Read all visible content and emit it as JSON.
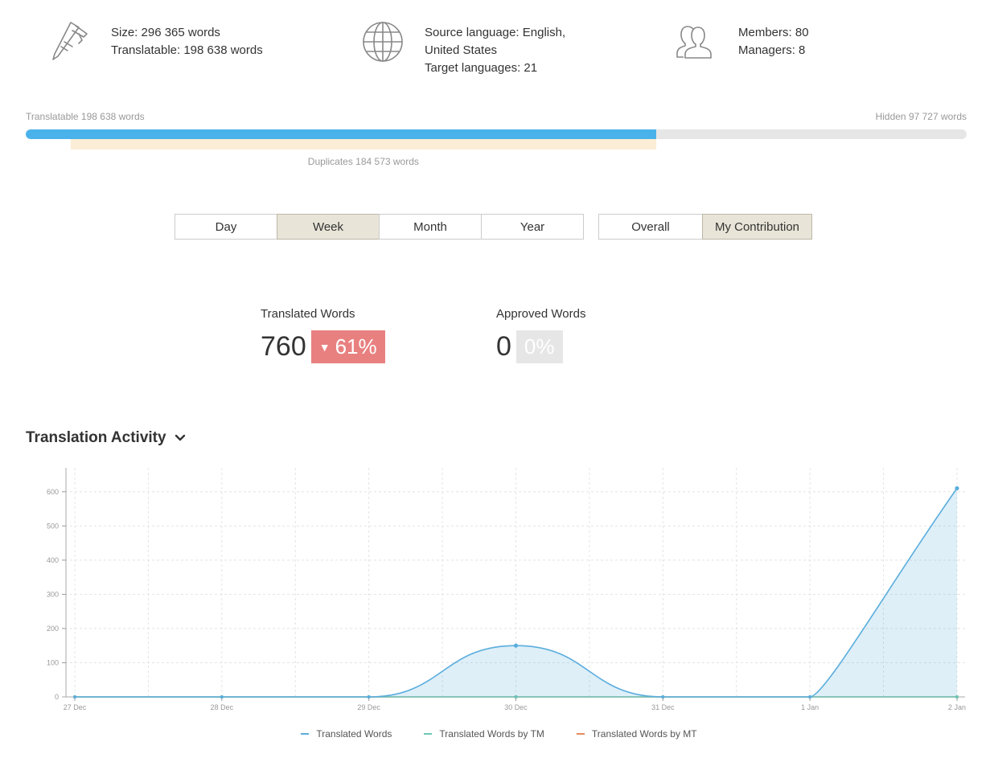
{
  "stats": {
    "size": {
      "icon": "caliper-icon",
      "line1": "Size: 296 365 words",
      "line2": "Translatable: 198 638 words"
    },
    "language": {
      "icon": "globe-icon",
      "line1": "Source language: English, United States",
      "line2": "Target languages: 21"
    },
    "members": {
      "icon": "users-icon",
      "line1": "Members: 80",
      "line2": "Managers: 8"
    }
  },
  "progress": {
    "translatable_label": "Translatable 198 638 words",
    "hidden_label": "Hidden 97 727 words",
    "duplicates_label": "Duplicates 184 573 words",
    "total_words": 296365,
    "translatable_words": 198638,
    "duplicate_words": 184573,
    "fill_color": "#4ab2ea",
    "duplicate_color": "#fbedd6"
  },
  "period_tabs": [
    {
      "label": "Day",
      "active": false
    },
    {
      "label": "Week",
      "active": true
    },
    {
      "label": "Month",
      "active": false
    },
    {
      "label": "Year",
      "active": false
    }
  ],
  "scope_tabs": [
    {
      "label": "Overall",
      "active": false
    },
    {
      "label": "My Contribution",
      "active": true
    }
  ],
  "metrics": {
    "translated": {
      "label": "Translated Words",
      "value": "760",
      "change": "61%",
      "trend": "down",
      "color": "#e98080"
    },
    "approved": {
      "label": "Approved Words",
      "value": "0",
      "change": "0%",
      "trend": "none",
      "color": "#e6e6e6"
    }
  },
  "section": {
    "title": "Translation Activity",
    "icon": "chevron-down-icon"
  },
  "chart_data": {
    "type": "area",
    "categories": [
      "27 Dec",
      "28 Dec",
      "29 Dec",
      "30 Dec",
      "31 Dec",
      "1 Jan",
      "2 Jan"
    ],
    "series": [
      {
        "name": "Translated Words",
        "values": [
          0,
          0,
          0,
          150,
          0,
          0,
          610
        ],
        "color": "#5aaddd"
      },
      {
        "name": "Translated Words by TM",
        "values": [
          0,
          0,
          0,
          0,
          0,
          0,
          0
        ],
        "color": "#6cc7b5"
      },
      {
        "name": "Translated Words by MT",
        "values": [
          0,
          0,
          0,
          0,
          0,
          0,
          0
        ],
        "color": "#e88a5a"
      }
    ],
    "yticks": [
      0,
      100,
      200,
      300,
      400,
      500,
      600
    ],
    "ylim": [
      0,
      670
    ],
    "grid": true,
    "legend": "bottom"
  }
}
